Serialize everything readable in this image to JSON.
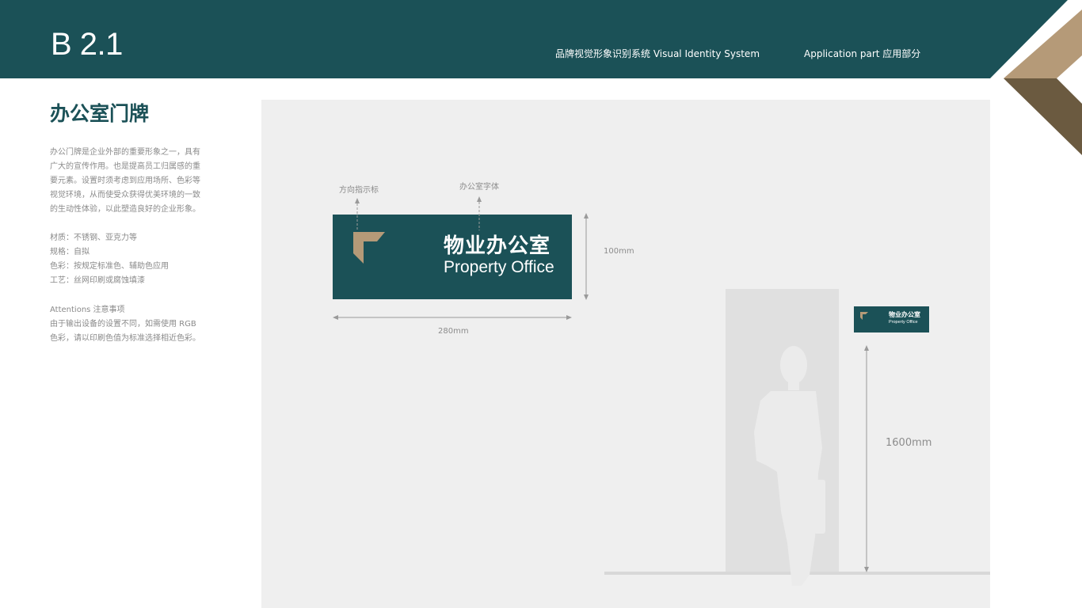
{
  "header": {
    "code": "B 2.1",
    "system_label": "品牌视觉形象识别系统   Visual Identity System",
    "part_label": "Application part  应用部分"
  },
  "content": {
    "title": "办公室门牌",
    "description": [
      "办公门牌是企业外部的重要形象之一，具有",
      "广大的宣传作用。也是提高员工归属感的重",
      "要元素。设置时须考虑到应用场所、色彩等",
      "视觉环境，从而使受众获得优美环境的一致",
      "的生动性体验，以此塑造良好的企业形象。"
    ],
    "specs": [
      "材质：不锈钢、亚克力等",
      "规格：自拟",
      "色彩：按规定标准色、辅助色应用",
      "工艺：丝网印刷或腐蚀填漆"
    ],
    "attention_title": "Attentions 注意事项",
    "attention": [
      "由于输出设备的设置不同，如需使用  RGB",
      "色彩，请以印刷色值为标准选择相近色彩。"
    ]
  },
  "diagram": {
    "label_indicator": "方向指示标",
    "label_font": "办公室字体",
    "height_dim": "100mm",
    "width_dim": "280mm",
    "mount_height": "1600mm",
    "sign_cn": "物业办公室",
    "sign_en": "Property Office"
  },
  "colors": {
    "brand_green": "#1b5157",
    "brand_tan": "#b59a78",
    "brand_brown": "#6b5a40"
  }
}
